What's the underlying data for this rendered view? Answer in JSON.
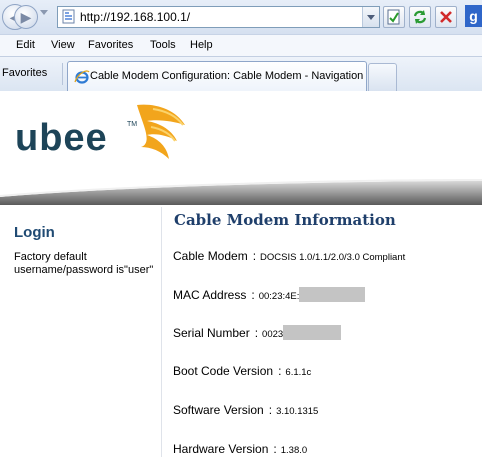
{
  "browser": {
    "url": "http://192.168.100.1/",
    "menu": [
      "Edit",
      "View",
      "Favorites",
      "Tools",
      "Help"
    ],
    "favorites_label": "Favorites",
    "tab_title": "Cable Modem Configuration: Cable Modem - Navigation",
    "search_letter": "g"
  },
  "logo": {
    "text": "ubee",
    "tm": "TM"
  },
  "sidebar": {
    "title": "Login",
    "note": "Factory default username/password is\"user\""
  },
  "main": {
    "title": "Cable Modem Information",
    "rows": [
      {
        "label": "Cable Modem",
        "value": "DOCSIS 1.0/1.1/2.0/3.0 Compliant"
      },
      {
        "label": "MAC Address",
        "value": "00:23:4E:"
      },
      {
        "label": "Serial Number",
        "value": "0023"
      },
      {
        "label": "Boot Code Version",
        "value": "6.1.1c"
      },
      {
        "label": "Software Version",
        "value": "3.10.1315"
      },
      {
        "label": "Hardware Version",
        "value": "1.38.0"
      }
    ],
    "separator": ":"
  },
  "colors": {
    "heading": "#1f3f6b",
    "login_title": "#1f4a73",
    "logo_text": "#1d4458",
    "logo_gold": "#f2a51c",
    "redaction": "#c4c4c4"
  }
}
